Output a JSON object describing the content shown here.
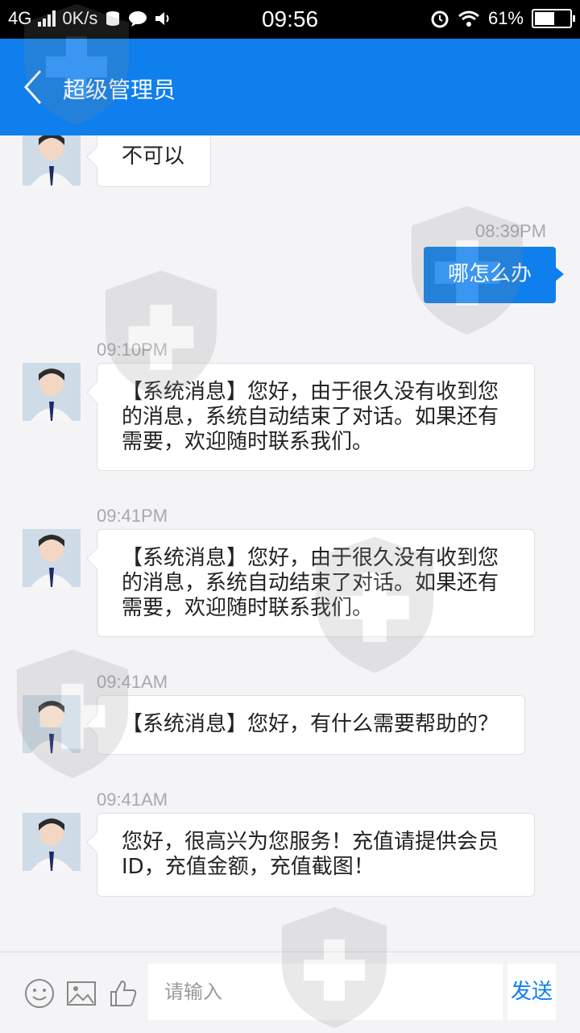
{
  "status_bar": {
    "network": "4G",
    "speed": "0K/s",
    "time": "09:56",
    "battery": "61%",
    "battery_level": 0.61
  },
  "header": {
    "title": "超级管理员"
  },
  "messages": [
    {
      "text": "不可以"
    },
    {
      "time": "08:39PM",
      "text": "哪怎么办"
    },
    {
      "time": "09:10PM",
      "text": "【系统消息】您好，由于很久没有收到您的消息，系统自动结束了对话。如果还有需要，欢迎随时联系我们。"
    },
    {
      "time": "09:41PM",
      "text": "【系统消息】您好，由于很久没有收到您的消息，系统自动结束了对话。如果还有需要，欢迎随时联系我们。"
    },
    {
      "time": "09:41AM",
      "text": "【系统消息】您好，有什么需要帮助的？"
    },
    {
      "time": "09:41AM",
      "text": "您好，很高兴为您服务！充值请提供会员ID，充值金额，充值截图！"
    }
  ],
  "input_bar": {
    "placeholder": "请输入",
    "send_label": "发送",
    "icons": [
      "emoji-icon",
      "image-icon",
      "thumbs-up-icon"
    ]
  },
  "colors": {
    "accent": "#0e7fed",
    "background": "#f4f4f6"
  }
}
